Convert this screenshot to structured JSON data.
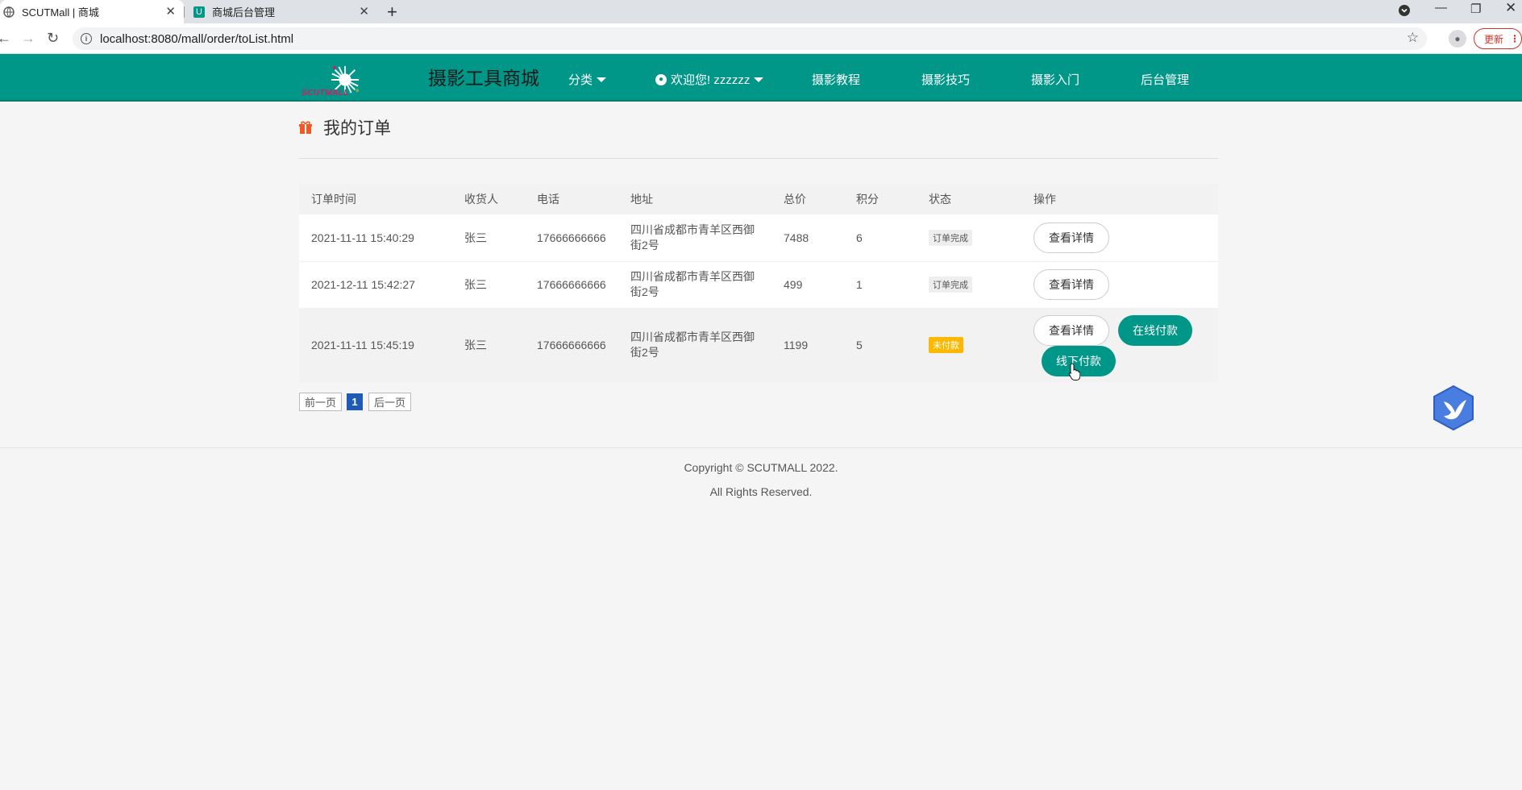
{
  "browser": {
    "tabs": [
      {
        "title": "SCUTMall | 商城",
        "active": true
      },
      {
        "title": "商城后台管理",
        "active": false
      }
    ],
    "url": "localhost:8080/mall/order/toList.html",
    "update_label": "更新"
  },
  "header": {
    "logo_text": "SCUTMALL",
    "site_title": "摄影工具商城",
    "nav": {
      "category": "分类",
      "user": "欢迎您! zzzzzz",
      "tutorial": "摄影教程",
      "tips": "摄影技巧",
      "beginner": "摄影入门",
      "admin": "后台管理"
    },
    "brand_color": "#009688"
  },
  "page": {
    "title": "我的订单"
  },
  "table": {
    "headers": [
      "订单时间",
      "收货人",
      "电话",
      "地址",
      "总价",
      "积分",
      "状态",
      "操作"
    ],
    "rows": [
      {
        "time": "2021-11-11 15:40:29",
        "receiver": "张三",
        "phone": "17666666666",
        "address": "四川省成都市青羊区西御街2号",
        "total": "7488",
        "points": "6",
        "status": "订单完成",
        "view": "查看详情"
      },
      {
        "time": "2021-12-11 15:42:27",
        "receiver": "张三",
        "phone": "17666666666",
        "address": "四川省成都市青羊区西御街2号",
        "total": "499",
        "points": "1",
        "status": "订单完成",
        "view": "查看详情"
      },
      {
        "time": "2021-11-11 15:45:19",
        "receiver": "张三",
        "phone": "17666666666",
        "address": "四川省成都市青羊区西御街2号",
        "total": "1199",
        "points": "5",
        "status": "未付款",
        "view": "查看详情",
        "pay_online": "在线付款",
        "pay_offline": "线下付款"
      }
    ],
    "status_colors": {
      "done": "#eeeeee",
      "unpaid": "#ffb800"
    }
  },
  "pager": {
    "prev": "前一页",
    "current": "1",
    "next": "后一页"
  },
  "footer": {
    "line1": "Copyright © SCUTMALL 2022.",
    "line2": "All Rights Reserved."
  }
}
